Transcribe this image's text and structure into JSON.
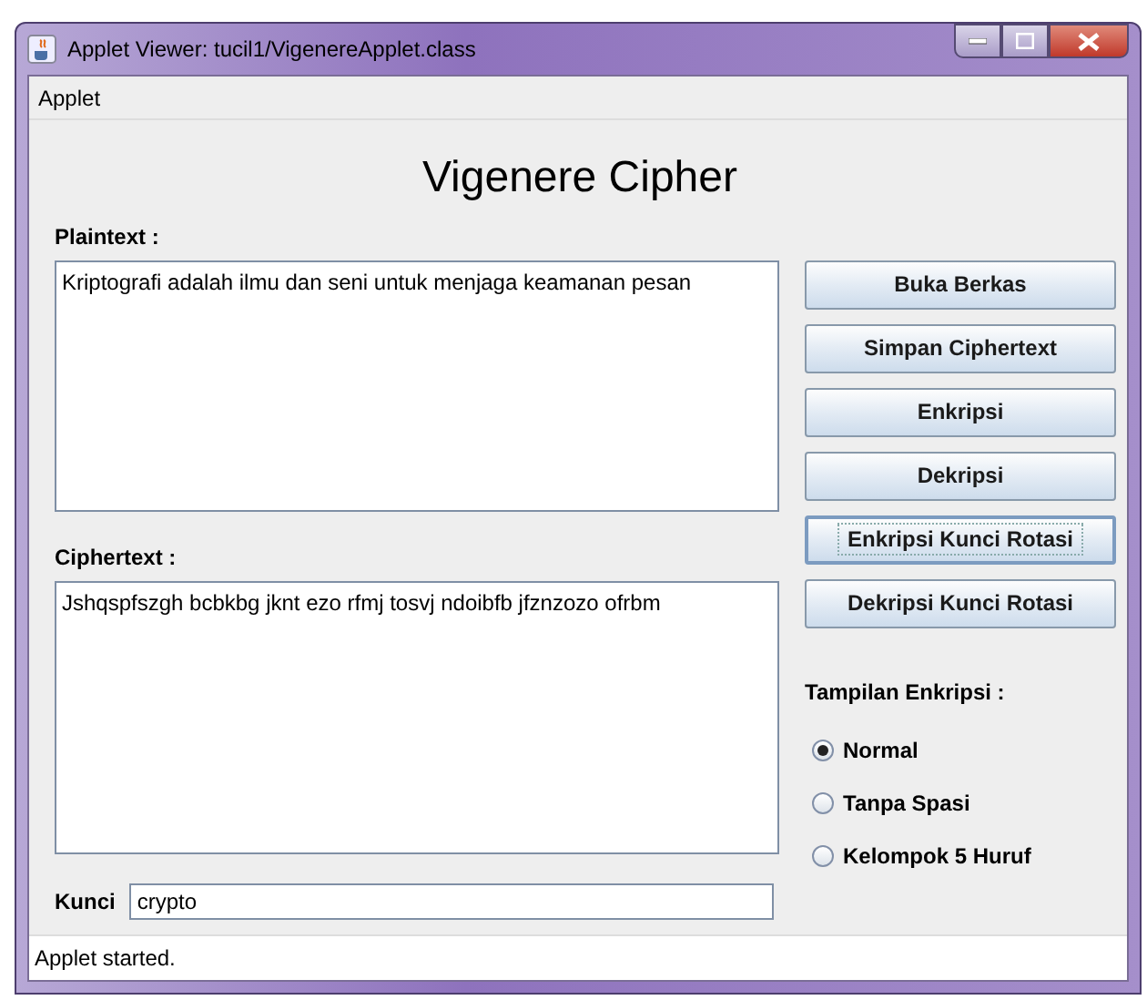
{
  "window": {
    "title": "Applet Viewer: tucil1/VigenereApplet.class"
  },
  "menu": [
    "Applet"
  ],
  "heading": "Vigenere Cipher",
  "plaintext": {
    "label": "Plaintext :",
    "value": "Kriptografi adalah ilmu dan seni untuk menjaga keamanan pesan"
  },
  "ciphertext": {
    "label": "Ciphertext :",
    "value": "Jshqspfszgh bcbkbg jknt ezo rfmj tosvj ndoibfb jfznzozo ofrbm"
  },
  "key": {
    "label": "Kunci",
    "value": "crypto"
  },
  "buttons": [
    {
      "label": "Buka Berkas",
      "focused": false
    },
    {
      "label": "Simpan Ciphertext",
      "focused": false
    },
    {
      "label": "Enkripsi",
      "focused": false
    },
    {
      "label": "Dekripsi",
      "focused": false
    },
    {
      "label": "Enkripsi Kunci Rotasi",
      "focused": true
    },
    {
      "label": "Dekripsi Kunci Rotasi",
      "focused": false
    }
  ],
  "display_options": {
    "label": "Tampilan Enkripsi :",
    "options": [
      {
        "label": "Normal",
        "selected": true
      },
      {
        "label": "Tanpa Spasi",
        "selected": false
      },
      {
        "label": "Kelompok 5 Huruf",
        "selected": false
      }
    ]
  },
  "status_bar": "Applet started."
}
